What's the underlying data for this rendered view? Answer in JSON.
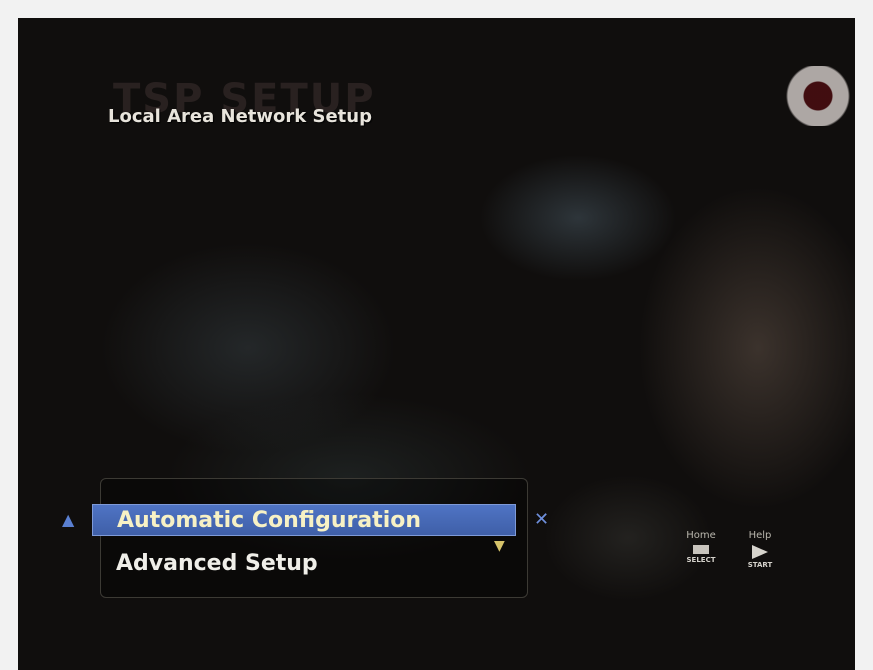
{
  "screen": {
    "overlay_title": "TSP SETUP",
    "title": "Local Area Network Setup"
  },
  "menu": {
    "items": [
      {
        "label": "Automatic Configuration",
        "selected": true
      },
      {
        "label": "Advanced Setup",
        "selected": false
      }
    ],
    "left_arrow_icon": "up-arrow-icon",
    "right_arrow_icon": "right-arrow-icon",
    "scroll_icon": "down-chevron-icon"
  },
  "hints": {
    "home": {
      "label": "Home",
      "key_caption": "SELECT"
    },
    "help": {
      "label": "Help",
      "key_caption": "START"
    }
  },
  "colors": {
    "selection": "#4f74c4",
    "selected_text": "#f7f1c5",
    "text": "#f0efe9"
  }
}
